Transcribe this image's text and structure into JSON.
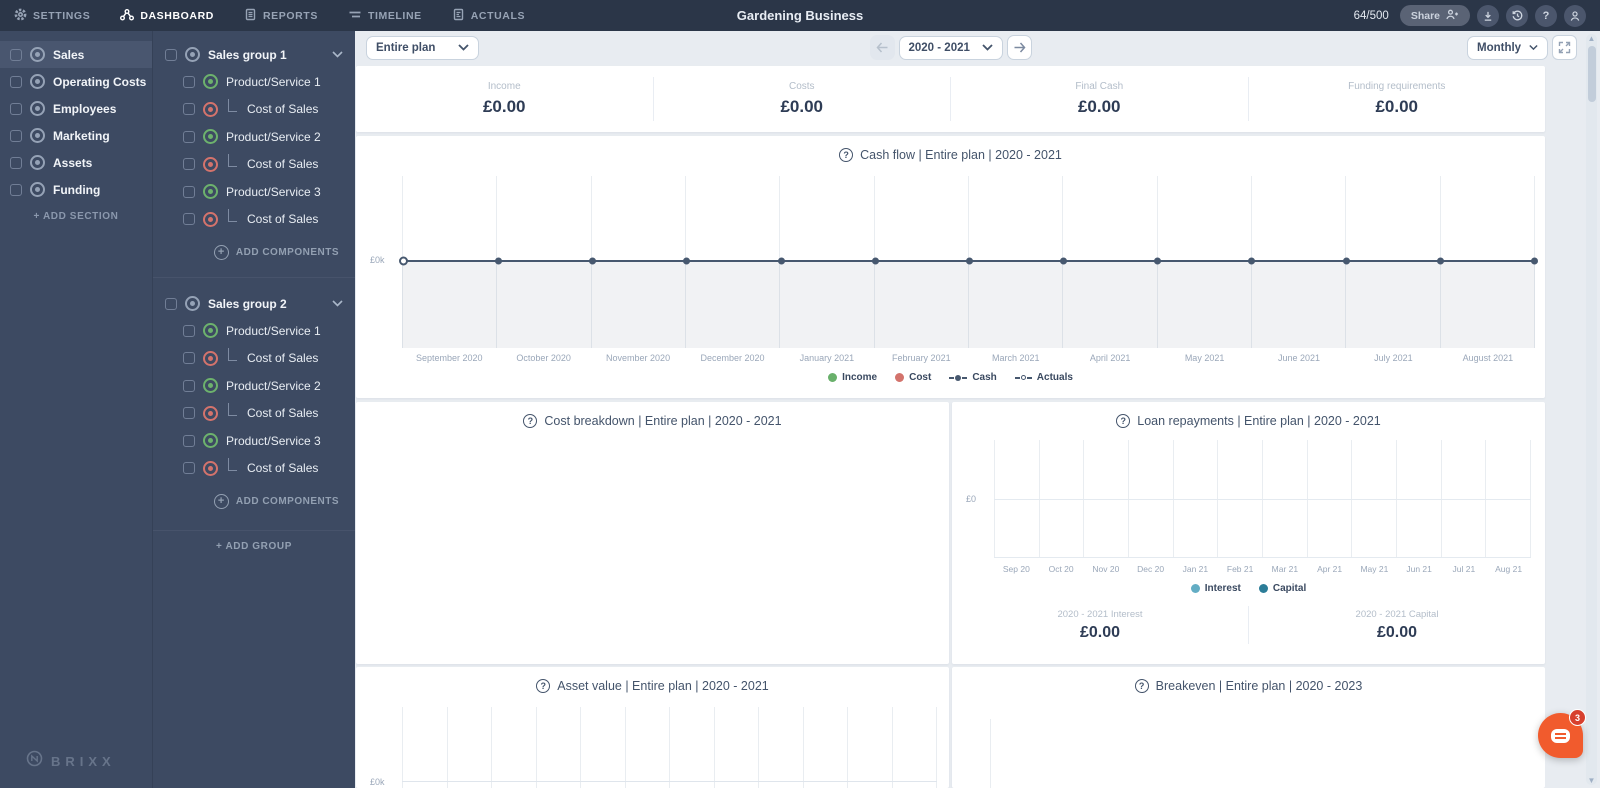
{
  "topbar": {
    "nav": [
      {
        "label": "SETTINGS"
      },
      {
        "label": "DASHBOARD"
      },
      {
        "label": "REPORTS"
      },
      {
        "label": "TIMELINE"
      },
      {
        "label": "ACTUALS"
      }
    ],
    "title": "Gardening Business",
    "usage_counter": "64/500",
    "share_label": "Share"
  },
  "sidebar": {
    "sections": [
      {
        "label": "Sales"
      },
      {
        "label": "Operating Costs"
      },
      {
        "label": "Employees"
      },
      {
        "label": "Marketing"
      },
      {
        "label": "Assets"
      },
      {
        "label": "Funding"
      }
    ],
    "add_section_label": "+ ADD SECTION",
    "brand": "BRIXX"
  },
  "groups": {
    "list": [
      {
        "label": "Sales group 1",
        "children": [
          {
            "label": "Product/Service 1",
            "type": "product"
          },
          {
            "label": "Cost of Sales",
            "type": "cost"
          },
          {
            "label": "Product/Service 2",
            "type": "product"
          },
          {
            "label": "Cost of Sales",
            "type": "cost"
          },
          {
            "label": "Product/Service 3",
            "type": "product"
          },
          {
            "label": "Cost of Sales",
            "type": "cost"
          }
        ],
        "add_components_label": "ADD COMPONENTS"
      },
      {
        "label": "Sales group 2",
        "children": [
          {
            "label": "Product/Service 1",
            "type": "product"
          },
          {
            "label": "Cost of Sales",
            "type": "cost"
          },
          {
            "label": "Product/Service 2",
            "type": "product"
          },
          {
            "label": "Cost of Sales",
            "type": "cost"
          },
          {
            "label": "Product/Service 3",
            "type": "product"
          },
          {
            "label": "Cost of Sales",
            "type": "cost"
          }
        ],
        "add_components_label": "ADD COMPONENTS"
      }
    ],
    "add_group_label": "+ ADD GROUP"
  },
  "toolbar": {
    "plan": "Entire plan",
    "period": "2020 - 2021",
    "frequency": "Monthly"
  },
  "kpis": [
    {
      "label": "Income",
      "value": "£0.00"
    },
    {
      "label": "Costs",
      "value": "£0.00"
    },
    {
      "label": "Final Cash",
      "value": "£0.00"
    },
    {
      "label": "Funding requirements",
      "value": "£0.00"
    }
  ],
  "cashflow": {
    "title": "Cash flow | Entire plan | 2020 - 2021",
    "y_tick": "£0k",
    "legend": [
      {
        "label": "Income",
        "color": "#69b06b"
      },
      {
        "label": "Cost",
        "color": "#d3736c"
      },
      {
        "label": "Cash",
        "color": "#47586f"
      },
      {
        "label": "Actuals",
        "color": "#47586f"
      }
    ],
    "chart_data": {
      "type": "line",
      "x": [
        "September 2020",
        "October 2020",
        "November 2020",
        "December 2020",
        "January 2021",
        "February 2021",
        "March 2021",
        "April 2021",
        "May 2021",
        "June 2021",
        "July 2021",
        "August 2021"
      ],
      "series": [
        {
          "name": "Cash",
          "values": [
            0,
            0,
            0,
            0,
            0,
            0,
            0,
            0,
            0,
            0,
            0,
            0
          ]
        },
        {
          "name": "Income",
          "values": [
            0,
            0,
            0,
            0,
            0,
            0,
            0,
            0,
            0,
            0,
            0,
            0
          ]
        },
        {
          "name": "Cost",
          "values": [
            0,
            0,
            0,
            0,
            0,
            0,
            0,
            0,
            0,
            0,
            0,
            0
          ]
        }
      ],
      "ylabel": "£k",
      "grid": true,
      "legend_position": "bottom"
    }
  },
  "cost_breakdown": {
    "title": "Cost breakdown | Entire plan | 2020 - 2021"
  },
  "loan_repayments": {
    "title": "Loan repayments | Entire plan | 2020 - 2021",
    "y_tick": "£0",
    "legend": [
      {
        "label": "Interest",
        "color": "#63adc4"
      },
      {
        "label": "Capital",
        "color": "#2c7d98"
      }
    ],
    "totals": [
      {
        "label": "2020 - 2021 Interest",
        "value": "£0.00"
      },
      {
        "label": "2020 - 2021 Capital",
        "value": "£0.00"
      }
    ],
    "chart_data": {
      "type": "bar",
      "x": [
        "Sep 20",
        "Oct 20",
        "Nov 20",
        "Dec 20",
        "Jan 21",
        "Feb 21",
        "Mar 21",
        "Apr 21",
        "May 21",
        "Jun 21",
        "Jul 21",
        "Aug 21"
      ],
      "series": [
        {
          "name": "Interest",
          "values": [
            0,
            0,
            0,
            0,
            0,
            0,
            0,
            0,
            0,
            0,
            0,
            0
          ]
        },
        {
          "name": "Capital",
          "values": [
            0,
            0,
            0,
            0,
            0,
            0,
            0,
            0,
            0,
            0,
            0,
            0
          ]
        }
      ],
      "grid": true,
      "legend_position": "bottom"
    }
  },
  "asset_value": {
    "title": "Asset value | Entire plan | 2020 - 2021",
    "y_tick": "£0k"
  },
  "breakeven": {
    "title": "Breakeven | Entire plan | 2020 - 2023"
  },
  "chat": {
    "badge": "3"
  }
}
